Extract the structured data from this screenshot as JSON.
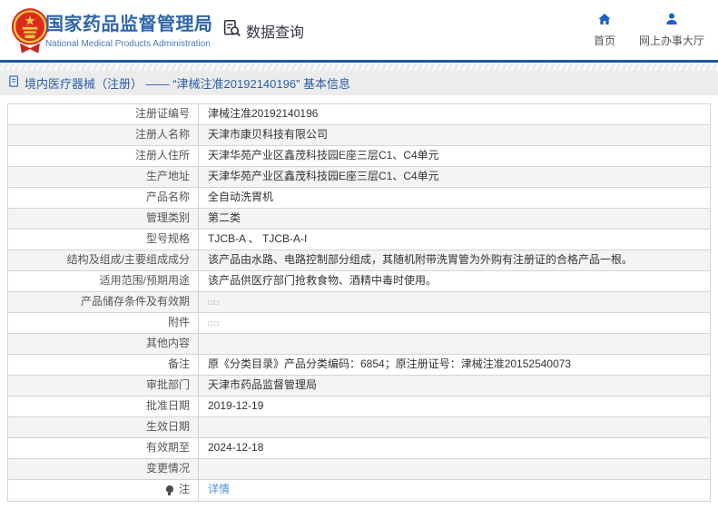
{
  "header": {
    "agency_name": "国家药品监督管理局",
    "agency_name_en": "National Medical Products Administration",
    "data_query_label": "数据查询",
    "nav_home": "首页",
    "nav_service_hall": "网上办事大厅"
  },
  "breadcrumb": {
    "text": "境内医疗器械（注册） —— “津械注准20192140196” 基本信息"
  },
  "table": {
    "rows": [
      {
        "label": "注册证编号",
        "value": "津械注准20192140196"
      },
      {
        "label": "注册人名称",
        "value": "天津市康贝科技有限公司"
      },
      {
        "label": "注册人住所",
        "value": "天津华苑产业区鑫茂科技园E座三层C1、C4单元"
      },
      {
        "label": "生产地址",
        "value": "天津华苑产业区鑫茂科技园E座三层C1、C4单元"
      },
      {
        "label": "产品名称",
        "value": "全自动洗胃机"
      },
      {
        "label": "管理类别",
        "value": "第二类"
      },
      {
        "label": "型号规格",
        "value": "TJCB-A 、 TJCB-A-I"
      },
      {
        "label": "结构及组成/主要组成成分",
        "value": "该产品由水路、电路控制部分组成，其随机附带洗胃管为外购有注册证的合格产品一根。"
      },
      {
        "label": "适用范围/预期用途",
        "value": "该产品供医疗部门抢救食物、酒精中毒时使用。"
      },
      {
        "label": "产品储存条件及有效期",
        "value": "□□",
        "tofu": true
      },
      {
        "label": "附件",
        "value": "□□",
        "tofu": true
      },
      {
        "label": "其他内容",
        "value": ""
      },
      {
        "label": "备注",
        "value": "原《分类目录》产品分类编码：6854；原注册证号：津械注准20152540073"
      },
      {
        "label": "审批部门",
        "value": "天津市药品监督管理局"
      },
      {
        "label": "批准日期",
        "value": "2019-12-19"
      },
      {
        "label": "生效日期",
        "value": ""
      },
      {
        "label": "有效期至",
        "value": "2024-12-18"
      },
      {
        "label": "变更情况",
        "value": ""
      },
      {
        "label": "注",
        "value": "详情",
        "link": true,
        "icon": "lightbulb"
      }
    ]
  },
  "colors": {
    "accent_blue": "#1f57a5",
    "title_blue": "#2e66ab",
    "nav_icon_blue": "#1c62c5",
    "link_blue": "#4a90d9",
    "emblem_red": "#de2a1c",
    "emblem_gold": "#f7c948",
    "breadcrumb_bg": "#ececec",
    "row_alt_bg": "#f4f4f4",
    "border": "#d4d4d4"
  }
}
